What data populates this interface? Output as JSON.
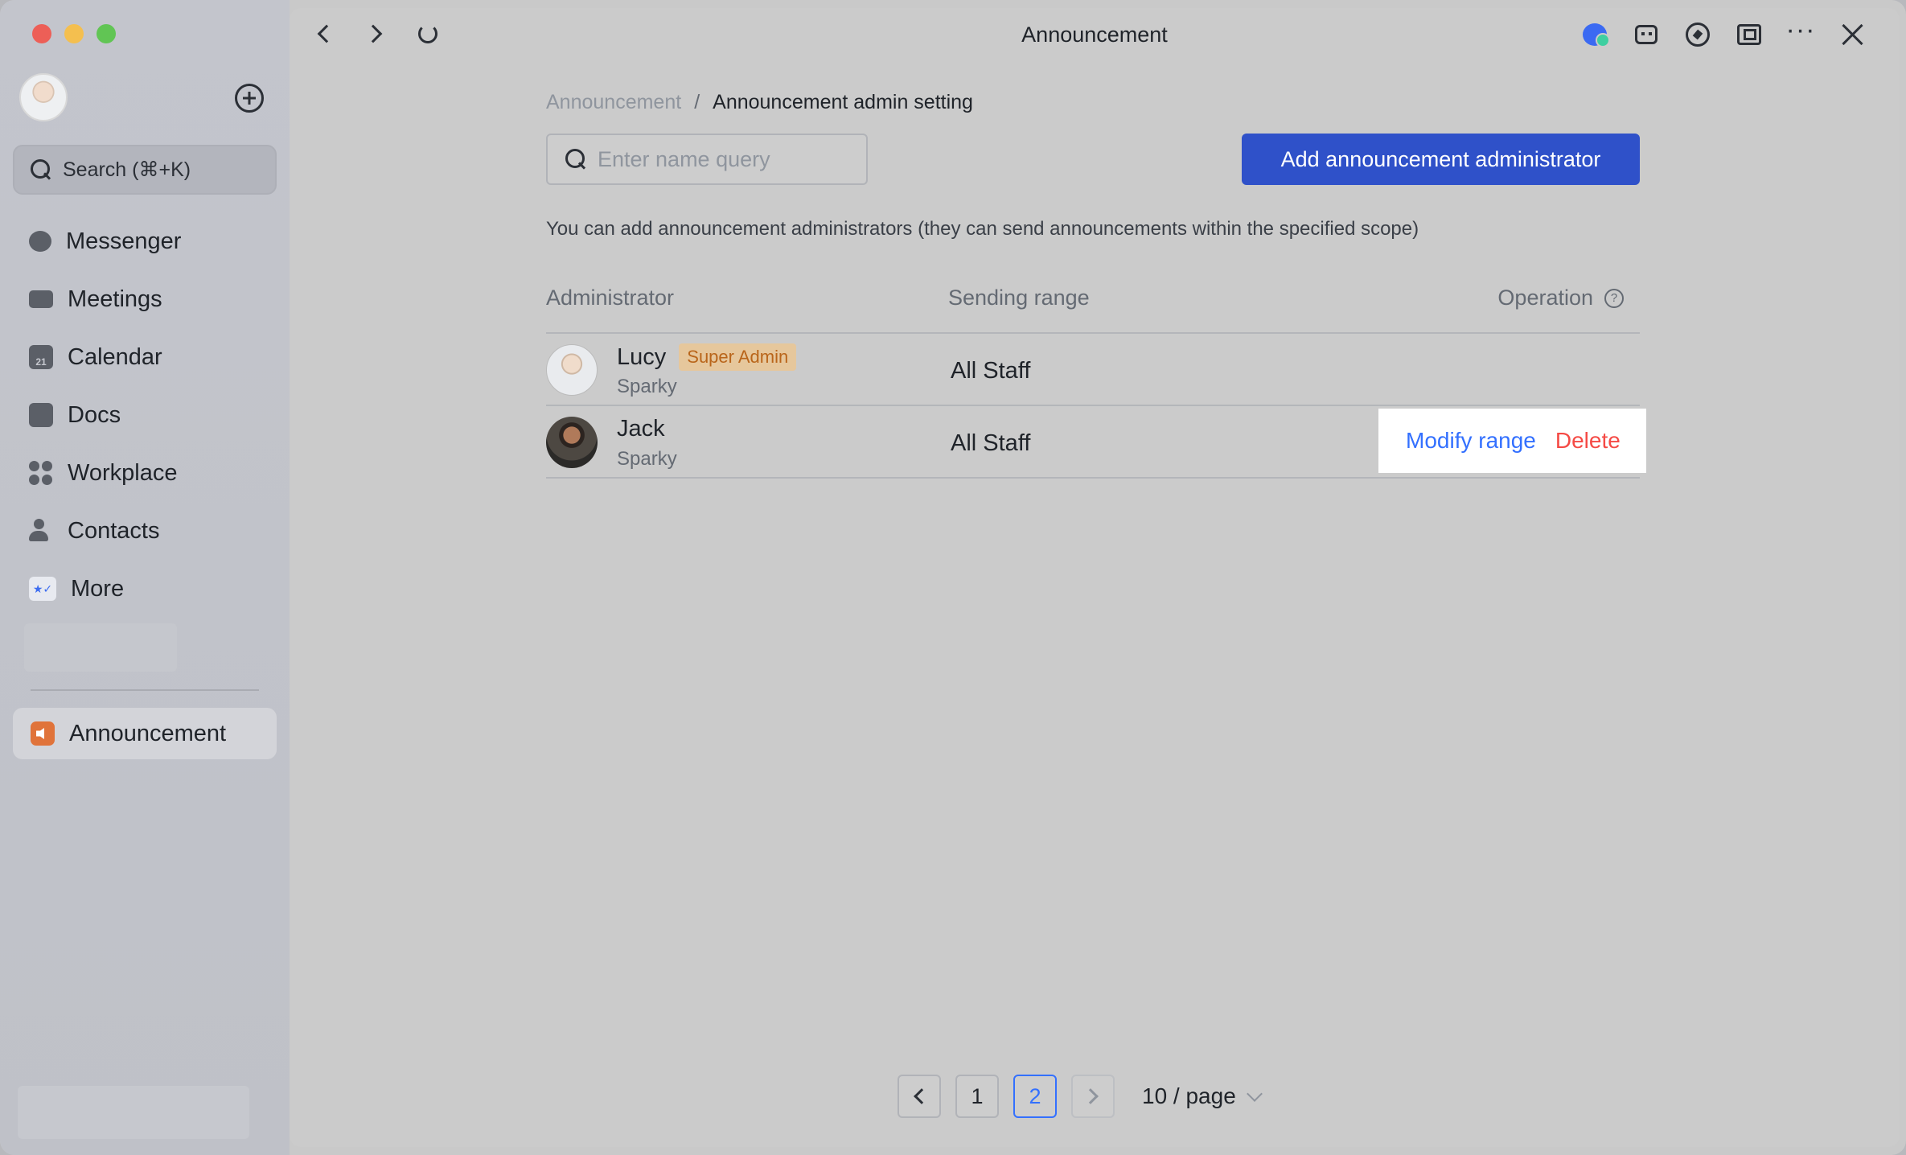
{
  "window": {
    "title": "Announcement"
  },
  "sidebar": {
    "search_label": "Search (⌘+K)",
    "items": [
      {
        "label": "Messenger",
        "icon": "messenger-icon"
      },
      {
        "label": "Meetings",
        "icon": "meetings-icon"
      },
      {
        "label": "Calendar",
        "icon": "calendar-icon",
        "icon_text": "21"
      },
      {
        "label": "Docs",
        "icon": "docs-icon"
      },
      {
        "label": "Workplace",
        "icon": "workplace-icon"
      },
      {
        "label": "Contacts",
        "icon": "contacts-icon"
      },
      {
        "label": "More",
        "icon": "more-icon",
        "icon_text": "★✓"
      }
    ],
    "pinned": {
      "label": "Announcement",
      "icon": "announcement-icon"
    }
  },
  "breadcrumb": {
    "parent": "Announcement",
    "separator": "/",
    "current": "Announcement admin setting"
  },
  "search": {
    "placeholder": "Enter name query"
  },
  "add_button": "Add announcement administrator",
  "hint": "You can add announcement administrators (they can send announcements within the specified scope)",
  "table": {
    "columns": {
      "admin": "Administrator",
      "range": "Sending range",
      "operation": "Operation"
    },
    "rows": [
      {
        "name": "Lucy",
        "badge": "Super Admin",
        "org": "Sparky",
        "range": "All Staff"
      },
      {
        "name": "Jack",
        "org": "Sparky",
        "range": "All Staff",
        "actions": {
          "modify": "Modify range",
          "delete": "Delete"
        }
      }
    ]
  },
  "pagination": {
    "pages": [
      "1",
      "2"
    ],
    "current": "2",
    "page_size": "10 / page"
  },
  "colors": {
    "primary": "#2f51c9",
    "link": "#3370ff",
    "danger": "#f54a45",
    "badge_bg": "#e6c79c",
    "badge_text": "#b9651a"
  }
}
